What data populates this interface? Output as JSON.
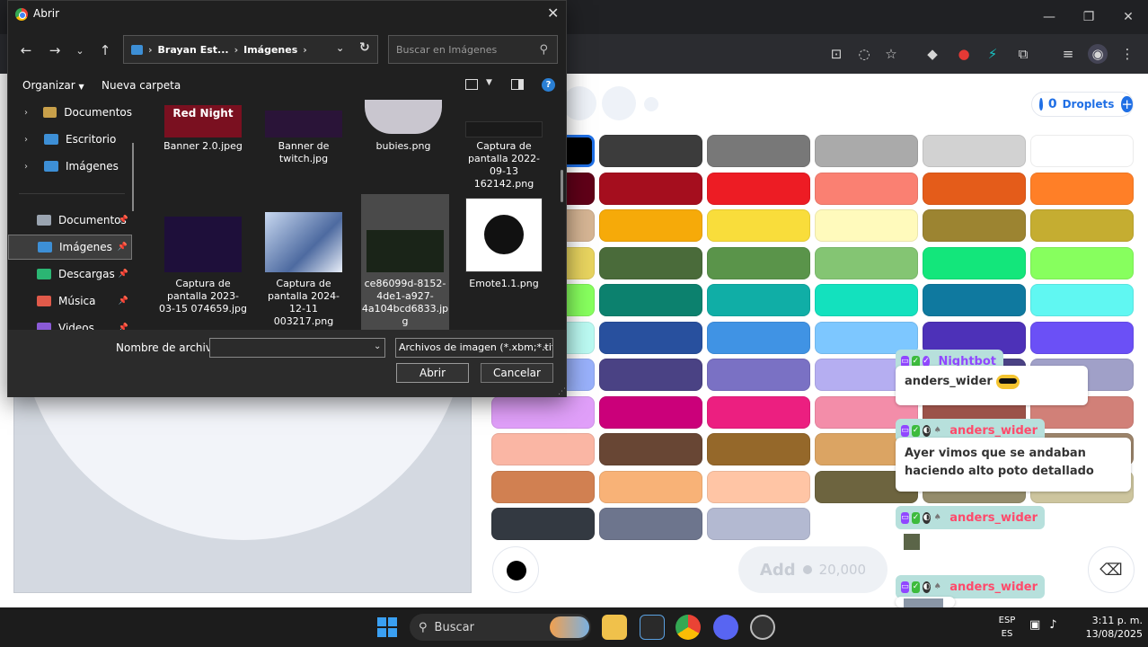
{
  "dialog": {
    "title": "Abrir",
    "address": {
      "segments": [
        "Brayan Est...",
        "Imágenes"
      ]
    },
    "search_placeholder": "Buscar en Imágenes",
    "toolbar": {
      "organize": "Organizar",
      "new_folder": "Nueva carpeta",
      "help": "?"
    },
    "nav_items": [
      {
        "label": "Documentos",
        "type": "tree",
        "color": "#c8a04a"
      },
      {
        "label": "Escritorio",
        "type": "tree",
        "color": "#3d8fd6"
      },
      {
        "label": "Imágenes",
        "type": "tree",
        "color": "#3d8fd6"
      },
      {
        "label": "Documentos",
        "type": "quick",
        "color": "#9aa4b0"
      },
      {
        "label": "Imágenes",
        "type": "quick",
        "color": "#3d8fd6"
      },
      {
        "label": "Descargas",
        "type": "quick",
        "color": "#2bb673"
      },
      {
        "label": "Música",
        "type": "quick",
        "color": "#e05a4a"
      },
      {
        "label": "Videos",
        "type": "quick",
        "color": "#8a5ad6"
      }
    ],
    "files": [
      {
        "name": "Banner 2.0.jpeg",
        "thumb_text": "Red Night"
      },
      {
        "name": "Banner de twitch.jpg"
      },
      {
        "name": "bubies.png"
      },
      {
        "name": "Captura de pantalla 2022-09-13 162142.png"
      },
      {
        "name": "Captura de pantalla 2023-03-15 074659.jpg"
      },
      {
        "name": "Captura de pantalla 2024-12-11 003217.png"
      },
      {
        "name": "ce86099d-8152-4de1-a927-4a104bcd6833.jpg"
      },
      {
        "name": "Emote1.1.png"
      }
    ],
    "filename_label": "Nombre de archivo:",
    "filename_value": "",
    "filetype": "Archivos de imagen (*.xbm;*.tif",
    "open_label": "Abrir",
    "cancel_label": "Cancelar"
  },
  "page": {
    "droplets_count": "0",
    "droplets_label": "Droplets",
    "add_label": "Add",
    "add_price": "20,000",
    "selected_color": "#000000",
    "palette": [
      "#000000",
      "#3c3c3c",
      "#787878",
      "#aaaaaa",
      "#d2d2d2",
      "#ffffff",
      "#600018",
      "#a50e1e",
      "#ed1c24",
      "#fa8072",
      "#e45c1a",
      "#ff7f27",
      "#d6b594",
      "#f6aa09",
      "#f9dd3b",
      "#fffabc",
      "#9c8431",
      "#c5ad31",
      "#e8d45f",
      "#4a6b3a",
      "#5a944a",
      "#84c573",
      "#13e67b",
      "#87ff5e",
      "#87ff5e",
      "#0c816e",
      "#10aea6",
      "#13e1be",
      "#0f799f",
      "#60f7f2",
      "#bbfaf2",
      "#28509e",
      "#4093e4",
      "#7dc7ff",
      "#4d31b8",
      "#6b50f6",
      "#99b1fb",
      "#4a4284",
      "#7a71c4",
      "#b5aef1",
      "#4a4284",
      "#a0a0c8",
      "#e09ff9",
      "#cb007a",
      "#ec1f80",
      "#f38da9",
      "#9b5249",
      "#d18078",
      "#fab6a4",
      "#684634",
      "#95682a",
      "#dba463",
      "#7b6352",
      "#9c846b",
      "#d18051",
      "#f8b277",
      "#ffc5a5",
      "#6d643f",
      "#948c6b",
      "#cdc59e",
      "#333941",
      "#6d758d",
      "#b3b9d1"
    ],
    "chat": [
      {
        "user": "Nightbot",
        "user_color": "#9147ff",
        "message": "anders_wider"
      },
      {
        "user": "anders_wider",
        "user_color": "#ff4a6b",
        "message": "Ayer vimos que se andaban haciendo alto poto detallado"
      },
      {
        "user": "anders_wider",
        "user_color": "#ff4a6b",
        "message": ""
      },
      {
        "user": "anders_wider",
        "user_color": "#ff4a6b",
        "message": ""
      }
    ]
  },
  "taskbar": {
    "search_placeholder": "Buscar",
    "lang_line1": "ESP",
    "lang_line2": "ES",
    "time": "3:11 p. m.",
    "date": "13/08/2025"
  }
}
